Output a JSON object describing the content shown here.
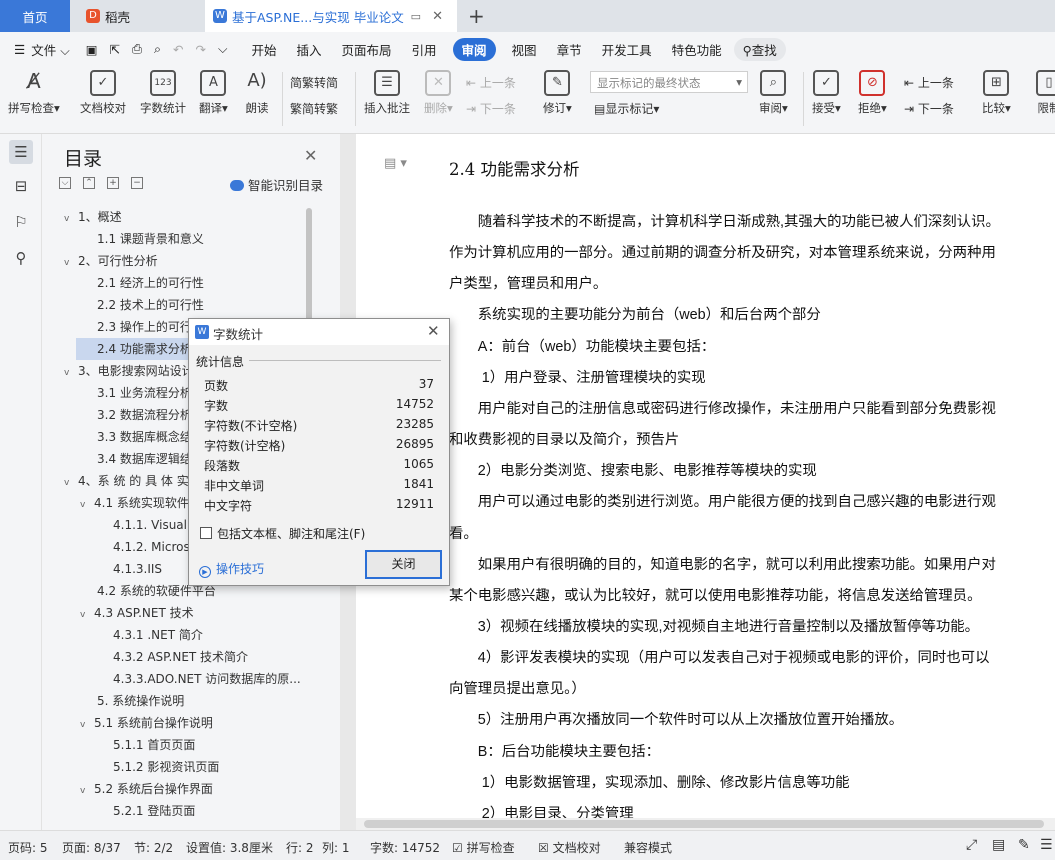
{
  "tabs": {
    "home": "首页",
    "daoke": "稻壳",
    "doc": "基于ASP.NE...与实现 毕业论文"
  },
  "menu": {
    "file": "文件",
    "items": [
      "开始",
      "插入",
      "页面布局",
      "引用",
      "审阅",
      "视图",
      "章节",
      "开发工具",
      "特色功能"
    ],
    "active_index": 4,
    "search": "查找"
  },
  "ribbon": {
    "spell": "拼写检查",
    "proof": "文档校对",
    "wordcount": "字数统计",
    "translate": "翻译",
    "read": "朗读",
    "trad": "繁转简",
    "simp": "简转繁",
    "insert_comment": "插入批注",
    "delete": "删除",
    "prev_item": "上一条",
    "next_item": "下一条",
    "revise": "修订",
    "markup_select": "显示标记的最终状态",
    "show_markup": "显示标记",
    "review": "审阅",
    "accept": "接受",
    "reject": "拒绝",
    "prev_change": "上一条",
    "next_change": "下一条",
    "compare": "比较",
    "limit": "限制"
  },
  "toc": {
    "title": "目录",
    "smart": "智能识别目录",
    "items": [
      {
        "label": "1、概述",
        "level": 1,
        "caret": "v"
      },
      {
        "label": "1.1 课题背景和意义",
        "level": 2,
        "caret": ""
      },
      {
        "label": "2、可行性分析",
        "level": 1,
        "caret": "v"
      },
      {
        "label": "2.1 经济上的可行性",
        "level": 2,
        "caret": ""
      },
      {
        "label": "2.2 技术上的可行性",
        "level": 2,
        "caret": ""
      },
      {
        "label": "2.3 操作上的可行性",
        "level": 2,
        "caret": ""
      },
      {
        "label": "2.4 功能需求分析",
        "level": 2,
        "caret": "",
        "selected": true
      },
      {
        "label": "3、电影搜索网站设计",
        "level": 1,
        "caret": "v"
      },
      {
        "label": "3.1 业务流程分析",
        "level": 2,
        "caret": ""
      },
      {
        "label": "3.2 数据流程分析",
        "level": 2,
        "caret": ""
      },
      {
        "label": "3.3 数据库概念结构设计",
        "level": 2,
        "caret": ""
      },
      {
        "label": "3.4 数据库逻辑结构设计",
        "level": 2,
        "caret": ""
      },
      {
        "label": "4、系 统 的 具 体 实 现",
        "level": 1,
        "caret": "v"
      },
      {
        "label": "4.1 系统实现软件环境",
        "level": 2,
        "caret": "v"
      },
      {
        "label": "4.1.1. Visual Studio",
        "level": 3,
        "caret": ""
      },
      {
        "label": "4.1.2. Microsoft",
        "level": 3,
        "caret": ""
      },
      {
        "label": "4.1.3.IIS",
        "level": 3,
        "caret": ""
      },
      {
        "label": "4.2 系统的软硬件平台",
        "level": 2,
        "caret": ""
      },
      {
        "label": "4.3 ASP.NET 技术",
        "level": 2,
        "caret": "v"
      },
      {
        "label": "4.3.1 .NET 简介",
        "level": 3,
        "caret": ""
      },
      {
        "label": "4.3.2 ASP.NET 技术简介",
        "level": 3,
        "caret": ""
      },
      {
        "label": "4.3.3.ADO.NET 访问数据库的原...",
        "level": 3,
        "caret": ""
      },
      {
        "label": "5. 系统操作说明",
        "level": 2,
        "caret": ""
      },
      {
        "label": "5.1 系统前台操作说明",
        "level": 2,
        "caret": "v"
      },
      {
        "label": "5.1.1 首页页面",
        "level": 3,
        "caret": ""
      },
      {
        "label": "5.1.2 影视资讯页面",
        "level": 3,
        "caret": ""
      },
      {
        "label": "5.2 系统后台操作界面",
        "level": 2,
        "caret": "v"
      },
      {
        "label": "5.2.1 登陆页面",
        "level": 3,
        "caret": ""
      }
    ]
  },
  "document": {
    "heading": "2.4 功能需求分析",
    "lines": [
      "　　随着科学技术的不断提高，计算机科学日渐成熟,其强大的功能已被人们深刻认识。",
      "作为计算机应用的一部分。通过前期的调查分析及研究，对本管理系统来说，分两种用",
      "户类型，管理员和用户。",
      "　　系统实现的主要功能分为前台（web）和后台两个部分",
      "　　A：前台（web）功能模块主要包括：",
      "　　 1）用户登录、注册管理模块的实现",
      "　　用户能对自己的注册信息或密码进行修改操作，未注册用户只能看到部分免费影视",
      "和收费影视的目录以及简介，预告片",
      "　　2）电影分类浏览、搜索电影、电影推荐等模块的实现",
      "　　用户可以通过电影的类别进行浏览。用户能很方便的找到自己感兴趣的电影进行观",
      "看。",
      "　　如果用户有很明确的目的，知道电影的名字，就可以利用此搜索功能。如果用户对",
      "某个电影感兴趣，或认为比较好，就可以使用电影推荐功能，将信息发送给管理员。",
      "　　3）视频在线播放模块的实现,对视频自主地进行音量控制以及播放暂停等功能。",
      "　　4）影评发表模块的实现（用户可以发表自己对于视频或电影的评价，同时也可以",
      "向管理员提出意见。）",
      "　　5）注册用户再次播放同一个软件时可以从上次播放位置开始播放。",
      "　　B：后台功能模块主要包括：",
      "　　 1）电影数据管理，实现添加、删除、修改影片信息等功能",
      "　　 2）电影目录、分类管理"
    ]
  },
  "dialog": {
    "title": "字数统计",
    "section": "统计信息",
    "stats": [
      {
        "label": "页数",
        "value": "37"
      },
      {
        "label": "字数",
        "value": "14752"
      },
      {
        "label": "字符数(不计空格)",
        "value": "23285"
      },
      {
        "label": "字符数(计空格)",
        "value": "26895"
      },
      {
        "label": "段落数",
        "value": "1065"
      },
      {
        "label": "非中文单词",
        "value": "1841"
      },
      {
        "label": "中文字符",
        "value": "12911"
      }
    ],
    "checkbox": "包括文本框、脚注和尾注(F)",
    "tips": "操作技巧",
    "close": "关闭"
  },
  "status": {
    "pagenum": "页码: 5",
    "page": "页面: 8/37",
    "section": "节: 2/2",
    "setting": "设置值: 3.8厘米",
    "row": "行: 2",
    "col": "列: 1",
    "words": "字数: 14752",
    "spell": "拼写检查",
    "proof": "文档校对",
    "compat": "兼容模式"
  },
  "colors": {
    "accent": "#2b6fd6",
    "tab_home": "#3a78d8",
    "toc_selected": "#c9d7ee"
  }
}
